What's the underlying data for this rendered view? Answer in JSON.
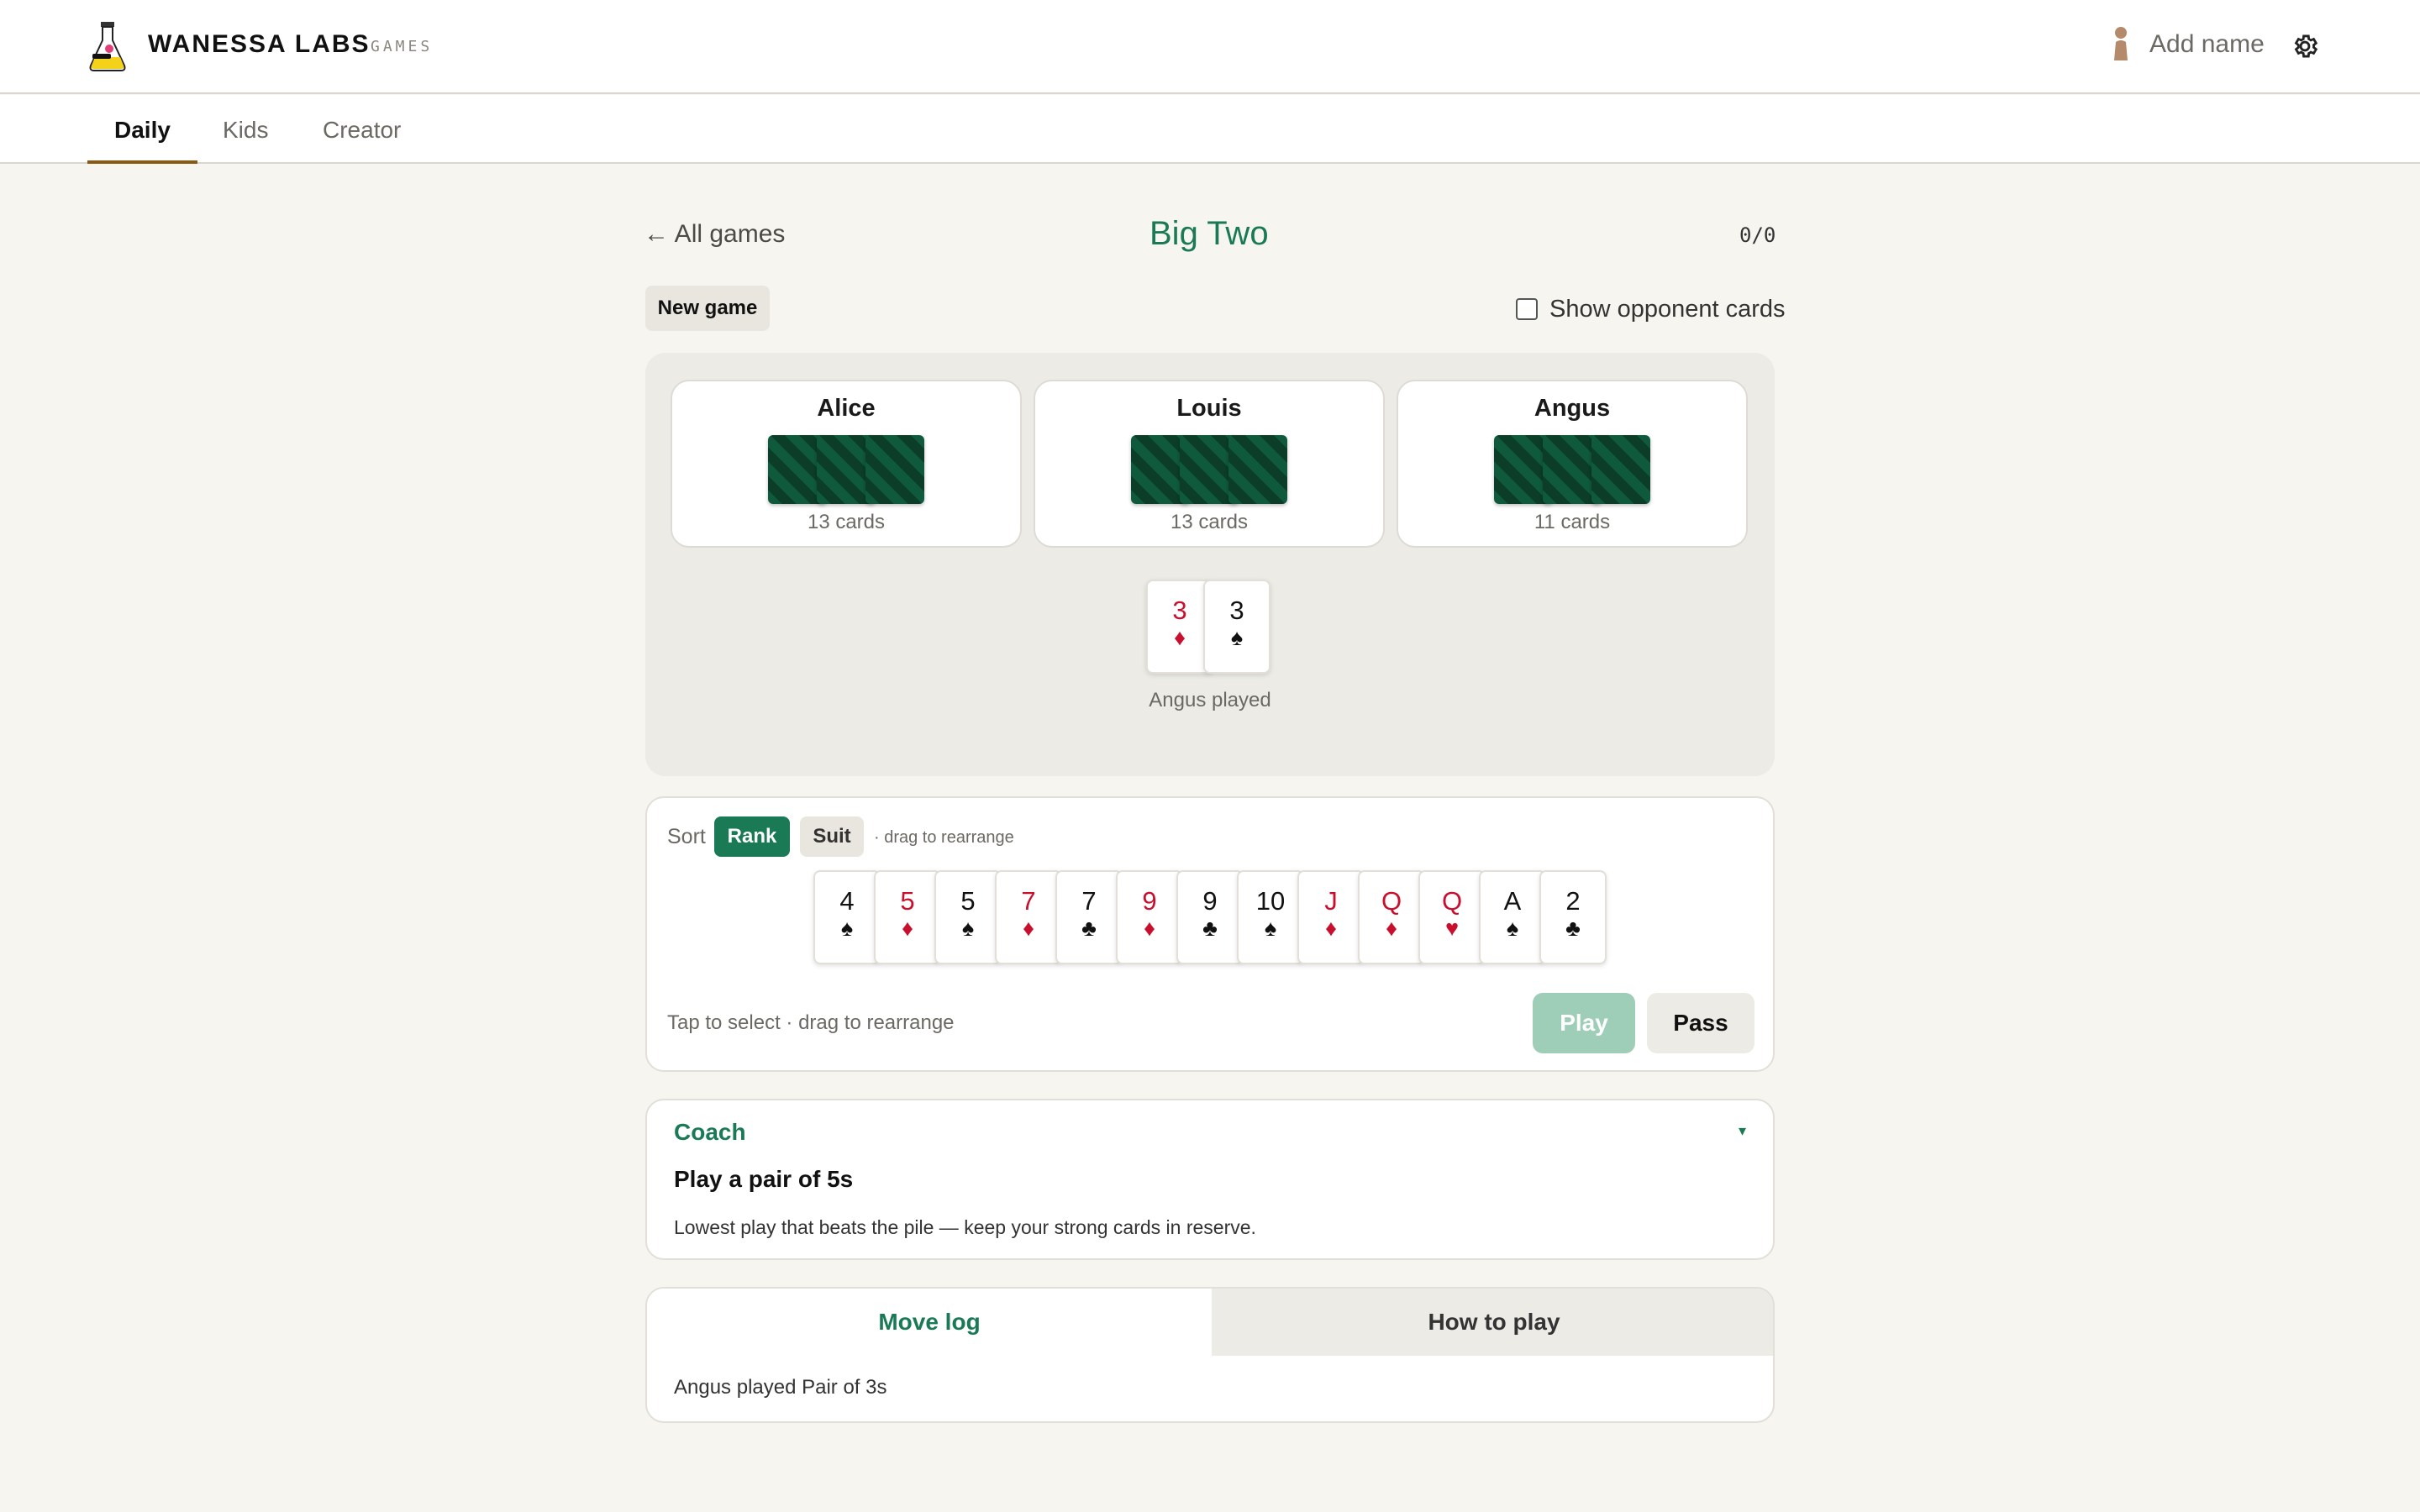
{
  "header": {
    "brand": "WANESSA LABS",
    "brand_sub": "GAMES",
    "add_name": "Add name"
  },
  "nav": {
    "tabs": [
      {
        "label": "Daily",
        "active": true
      },
      {
        "label": "Kids",
        "active": false
      },
      {
        "label": "Creator",
        "active": false
      }
    ]
  },
  "game": {
    "back_label": "← All games",
    "title": "Big Two",
    "score": "0/0",
    "new_game_label": "New game",
    "show_opponent_label": "Show opponent cards",
    "show_opponent_checked": false
  },
  "opponents": [
    {
      "name": "Alice",
      "count_label": "13 cards"
    },
    {
      "name": "Louis",
      "count_label": "13 cards"
    },
    {
      "name": "Angus",
      "count_label": "11 cards"
    }
  ],
  "pile": {
    "cards": [
      {
        "rank": "3",
        "suit": "♦",
        "color": "red"
      },
      {
        "rank": "3",
        "suit": "♠",
        "color": "black"
      }
    ],
    "label": "Angus played"
  },
  "hand": {
    "sort_label": "Sort",
    "sort_rank": "Rank",
    "sort_suit": "Suit",
    "drag_hint": "· drag to rearrange",
    "cards": [
      {
        "rank": "4",
        "suit": "♠",
        "color": "black"
      },
      {
        "rank": "5",
        "suit": "♦",
        "color": "red"
      },
      {
        "rank": "5",
        "suit": "♠",
        "color": "black"
      },
      {
        "rank": "7",
        "suit": "♦",
        "color": "red"
      },
      {
        "rank": "7",
        "suit": "♣",
        "color": "black"
      },
      {
        "rank": "9",
        "suit": "♦",
        "color": "red"
      },
      {
        "rank": "9",
        "suit": "♣",
        "color": "black"
      },
      {
        "rank": "10",
        "suit": "♠",
        "color": "black"
      },
      {
        "rank": "J",
        "suit": "♦",
        "color": "red"
      },
      {
        "rank": "Q",
        "suit": "♦",
        "color": "red"
      },
      {
        "rank": "Q",
        "suit": "♥",
        "color": "red"
      },
      {
        "rank": "A",
        "suit": "♠",
        "color": "black"
      },
      {
        "rank": "2",
        "suit": "♣",
        "color": "black"
      }
    ],
    "tap_hint": "Tap to select · drag to rearrange",
    "play_label": "Play",
    "pass_label": "Pass"
  },
  "coach": {
    "title": "Coach",
    "toggle": "▾",
    "headline": "Play a pair of 5s",
    "body": "Lowest play that beats the pile — keep your strong cards in reserve."
  },
  "log": {
    "tab_move_log": "Move log",
    "tab_how_to": "How to play",
    "entries": [
      "Angus played Pair of 3s"
    ]
  },
  "colors": {
    "accent": "#1a7a55",
    "card_back": "#0f5a3c",
    "red_suit": "#c8102e",
    "tab_underline": "#8a5a14"
  }
}
